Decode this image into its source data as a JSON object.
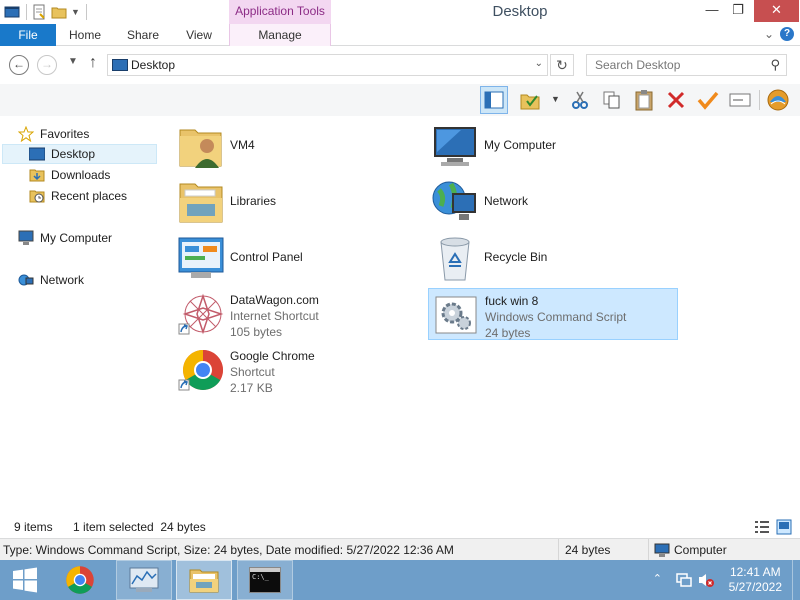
{
  "window": {
    "title": "Desktop",
    "context_tab": "Application Tools",
    "controls": {
      "minimize": "—",
      "maximize": "❐",
      "close": "✕"
    }
  },
  "ribbon": {
    "tabs": [
      "File",
      "Home",
      "Share",
      "View",
      "Manage"
    ],
    "expand_glyph": "⌄",
    "help_glyph": "?"
  },
  "address": {
    "path": "Desktop",
    "search_placeholder": "Search Desktop"
  },
  "nav": {
    "favorites": "Favorites",
    "desktop": "Desktop",
    "downloads": "Downloads",
    "recent": "Recent places",
    "computer": "My Computer",
    "network": "Network"
  },
  "items": {
    "vm4": {
      "name": "VM4"
    },
    "mycomputer": {
      "name": "My Computer"
    },
    "libraries": {
      "name": "Libraries"
    },
    "network": {
      "name": "Network"
    },
    "controlpanel": {
      "name": "Control Panel"
    },
    "recyclebin": {
      "name": "Recycle Bin"
    },
    "datawagon": {
      "name": "DataWagon.com",
      "type": "Internet Shortcut",
      "size": "105 bytes"
    },
    "fuckwin8": {
      "name": "fuck win 8",
      "type": "Windows Command Script",
      "size": "24 bytes"
    },
    "chrome": {
      "name": "Google Chrome",
      "type": "Shortcut",
      "size": "2.17 KB"
    }
  },
  "status": {
    "count": "9 items",
    "selected": "1 item selected  24 bytes"
  },
  "details": {
    "info": "Type: Windows Command Script, Size: 24 bytes, Date modified: 5/27/2022 12:36 AM",
    "size": "24 bytes",
    "location": "Computer"
  },
  "taskbar": {
    "time": "12:41 AM",
    "date": "5/27/2022",
    "tray_chevron": "⌃",
    "cmd_prompt": "C:\\_"
  },
  "colors": {
    "file_tab": "#1979ca",
    "taskbar": "#6e9ec9",
    "selection": "#cde8ff",
    "close_button": "#c74f50"
  }
}
